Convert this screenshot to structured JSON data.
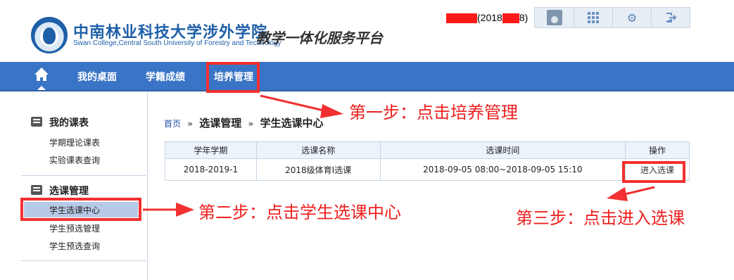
{
  "header": {
    "school_name_cn": "中南林业科技大学涉外学院",
    "school_name_en": "Swan College,Central South University of Forestry and Technology",
    "platform_title": "教学一体化服务平台",
    "user_open": "(2018",
    "user_close": "8)"
  },
  "toolbar": {
    "icons": [
      "avatar-icon",
      "apps-grid-icon",
      "gear-icon",
      "logout-icon"
    ]
  },
  "nav": {
    "items": [
      {
        "label": "我的桌面"
      },
      {
        "label": "学籍成绩"
      },
      {
        "label": "培养管理"
      }
    ]
  },
  "sidebar": {
    "groups": [
      {
        "title": "我的课表",
        "items": [
          "学期理论课表",
          "实验课表查询"
        ]
      },
      {
        "title": "选课管理",
        "items": [
          "学生选课中心",
          "学生预选管理",
          "学生预选查询"
        ]
      }
    ],
    "active_item": "学生选课中心"
  },
  "breadcrumb": {
    "home": "首页",
    "separator": "»",
    "level1": "选课管理",
    "level2": "学生选课中心"
  },
  "table": {
    "headers": [
      "学年学期",
      "选课名称",
      "选课时间",
      "操作"
    ],
    "rows": [
      {
        "term": "2018-2019-1",
        "name": "2018级体育Ⅰ选课",
        "time": "2018-09-05 08:00~2018-09-05 15:10",
        "action": "进入选课"
      }
    ]
  },
  "annotations": {
    "step1": "第一步：点击培养管理",
    "step2": "第二步：点击学生选课中心",
    "step3": "第三步：点击进入选课"
  },
  "colors": {
    "nav_bg": "#3a74c6",
    "brand_blue": "#1e5fa8",
    "annotation_red": "#ee2020",
    "active_item_bg": "#b6c9e6"
  }
}
